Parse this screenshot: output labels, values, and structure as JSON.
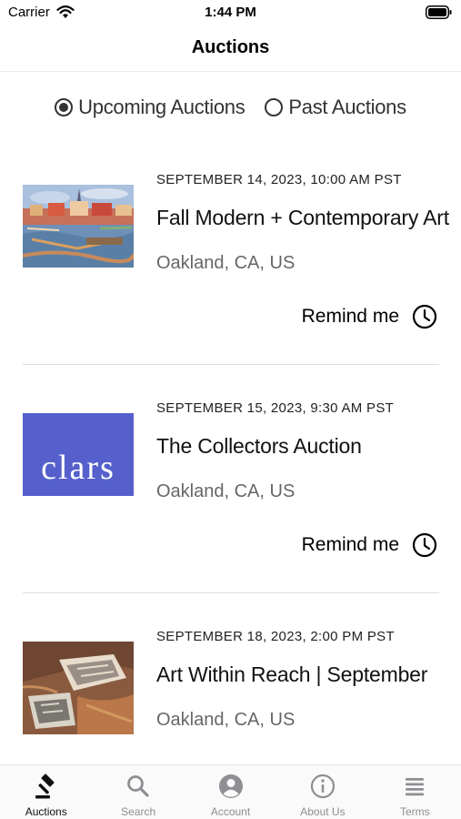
{
  "status_bar": {
    "carrier": "Carrier",
    "time": "1:44 PM"
  },
  "nav": {
    "title": "Auctions"
  },
  "filter": {
    "options": [
      {
        "label": "Upcoming Auctions",
        "selected": true
      },
      {
        "label": "Past Auctions",
        "selected": false
      }
    ]
  },
  "auctions": [
    {
      "date": "SEPTEMBER 14, 2023, 10:00 AM PST",
      "title": "Fall Modern + Contemporary Art",
      "location": "Oakland, CA, US",
      "remind_label": "Remind me"
    },
    {
      "date": "SEPTEMBER 15, 2023, 9:30 AM PST",
      "title": "The Collectors Auction",
      "location": "Oakland, CA, US",
      "remind_label": "Remind me",
      "logo_text": "clars"
    },
    {
      "date": "SEPTEMBER 18, 2023, 2:00 PM PST",
      "title": "Art Within Reach | September",
      "location": "Oakland, CA, US"
    }
  ],
  "tabs": [
    {
      "label": "Auctions",
      "icon": "gavel-icon",
      "active": true
    },
    {
      "label": "Search",
      "icon": "search-icon",
      "active": false
    },
    {
      "label": "Account",
      "icon": "account-icon",
      "active": false
    },
    {
      "label": "About Us",
      "icon": "info-icon",
      "active": false
    },
    {
      "label": "Terms",
      "icon": "terms-icon",
      "active": false
    }
  ],
  "colors": {
    "clars_logo_bg": "#5560cc",
    "tab_active": "#111111",
    "tab_inactive": "#8e8e93"
  }
}
